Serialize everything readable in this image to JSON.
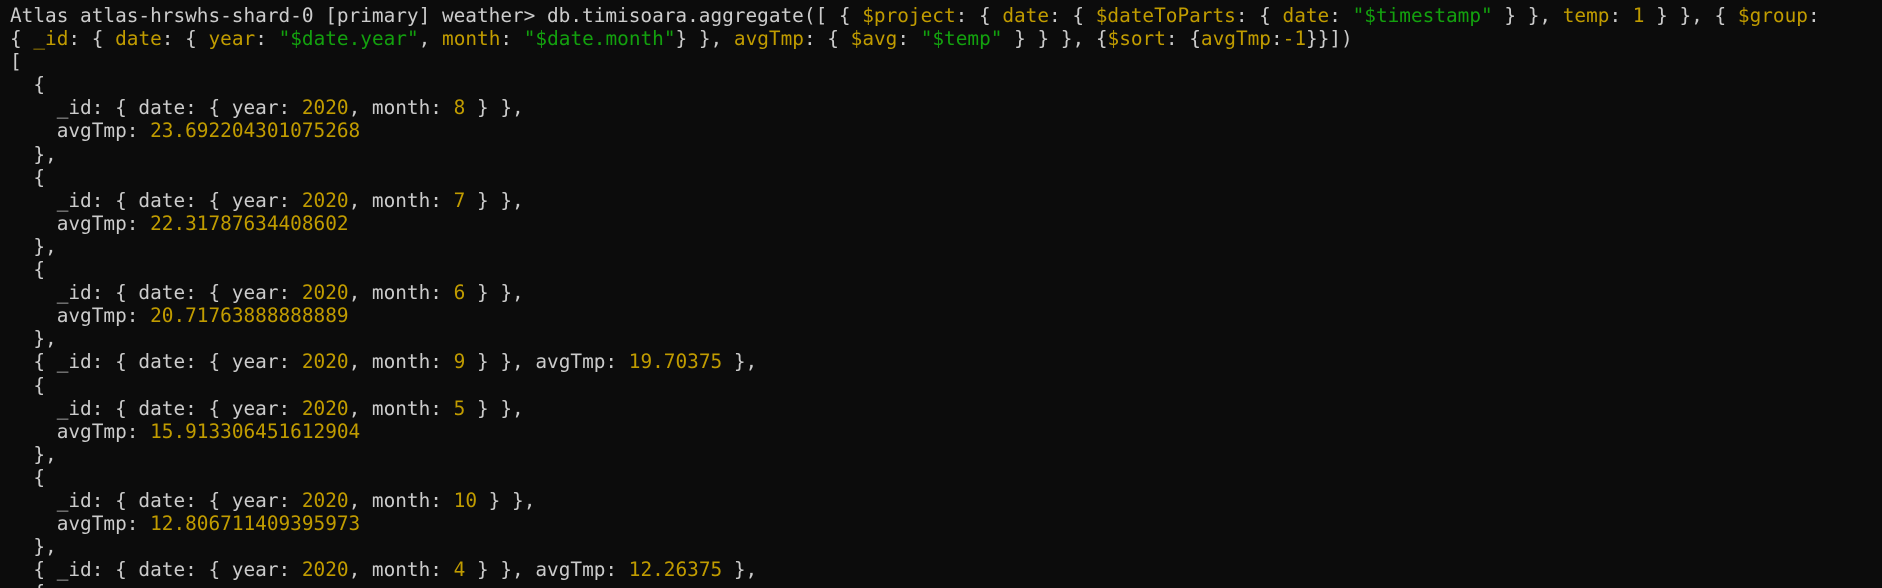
{
  "colors": {
    "background": "#0c0c0c",
    "text": "#cccccc",
    "key": "#c19c00",
    "string": "#13a10e"
  },
  "lines": [
    [
      {
        "t": "Atlas atlas-hrswhs-shard-0 [primary] weather> db.timisoara.aggregate([ { ",
        "c": "w"
      },
      {
        "t": "$project",
        "c": "k"
      },
      {
        "t": ": { ",
        "c": "w"
      },
      {
        "t": "date",
        "c": "k"
      },
      {
        "t": ": { ",
        "c": "w"
      },
      {
        "t": "$dateToParts",
        "c": "k"
      },
      {
        "t": ": { ",
        "c": "w"
      },
      {
        "t": "date",
        "c": "k"
      },
      {
        "t": ": ",
        "c": "w"
      },
      {
        "t": "\"$timestamp\"",
        "c": "s"
      },
      {
        "t": " } }, ",
        "c": "w"
      },
      {
        "t": "temp",
        "c": "k"
      },
      {
        "t": ": ",
        "c": "w"
      },
      {
        "t": "1",
        "c": "k"
      },
      {
        "t": " } }, { ",
        "c": "w"
      },
      {
        "t": "$group",
        "c": "k"
      },
      {
        "t": ":",
        "c": "w"
      }
    ],
    [
      {
        "t": "{ ",
        "c": "w"
      },
      {
        "t": "_id",
        "c": "k"
      },
      {
        "t": ": { ",
        "c": "w"
      },
      {
        "t": "date",
        "c": "k"
      },
      {
        "t": ": { ",
        "c": "w"
      },
      {
        "t": "year",
        "c": "k"
      },
      {
        "t": ": ",
        "c": "w"
      },
      {
        "t": "\"$date.year\"",
        "c": "s"
      },
      {
        "t": ", ",
        "c": "w"
      },
      {
        "t": "month",
        "c": "k"
      },
      {
        "t": ": ",
        "c": "w"
      },
      {
        "t": "\"$date.month\"",
        "c": "s"
      },
      {
        "t": "} }, ",
        "c": "w"
      },
      {
        "t": "avgTmp",
        "c": "k"
      },
      {
        "t": ": { ",
        "c": "w"
      },
      {
        "t": "$avg",
        "c": "k"
      },
      {
        "t": ": ",
        "c": "w"
      },
      {
        "t": "\"$temp\"",
        "c": "s"
      },
      {
        "t": " } } }, {",
        "c": "w"
      },
      {
        "t": "$sort",
        "c": "k"
      },
      {
        "t": ": {",
        "c": "w"
      },
      {
        "t": "avgTmp",
        "c": "k"
      },
      {
        "t": ":",
        "c": "w"
      },
      {
        "t": "-1",
        "c": "k"
      },
      {
        "t": "}}])",
        "c": "w"
      }
    ],
    [
      {
        "t": "[",
        "c": "w"
      }
    ],
    [
      {
        "t": "  {",
        "c": "w"
      }
    ],
    [
      {
        "t": "    _id: { date: { year: ",
        "c": "w"
      },
      {
        "t": "2020",
        "c": "k"
      },
      {
        "t": ", month: ",
        "c": "w"
      },
      {
        "t": "8",
        "c": "k"
      },
      {
        "t": " } },",
        "c": "w"
      }
    ],
    [
      {
        "t": "    avgTmp: ",
        "c": "w"
      },
      {
        "t": "23.692204301075268",
        "c": "k"
      }
    ],
    [
      {
        "t": "  },",
        "c": "w"
      }
    ],
    [
      {
        "t": "  {",
        "c": "w"
      }
    ],
    [
      {
        "t": "    _id: { date: { year: ",
        "c": "w"
      },
      {
        "t": "2020",
        "c": "k"
      },
      {
        "t": ", month: ",
        "c": "w"
      },
      {
        "t": "7",
        "c": "k"
      },
      {
        "t": " } },",
        "c": "w"
      }
    ],
    [
      {
        "t": "    avgTmp: ",
        "c": "w"
      },
      {
        "t": "22.31787634408602",
        "c": "k"
      }
    ],
    [
      {
        "t": "  },",
        "c": "w"
      }
    ],
    [
      {
        "t": "  {",
        "c": "w"
      }
    ],
    [
      {
        "t": "    _id: { date: { year: ",
        "c": "w"
      },
      {
        "t": "2020",
        "c": "k"
      },
      {
        "t": ", month: ",
        "c": "w"
      },
      {
        "t": "6",
        "c": "k"
      },
      {
        "t": " } },",
        "c": "w"
      }
    ],
    [
      {
        "t": "    avgTmp: ",
        "c": "w"
      },
      {
        "t": "20.71763888888889",
        "c": "k"
      }
    ],
    [
      {
        "t": "  },",
        "c": "w"
      }
    ],
    [
      {
        "t": "  { _id: { date: { year: ",
        "c": "w"
      },
      {
        "t": "2020",
        "c": "k"
      },
      {
        "t": ", month: ",
        "c": "w"
      },
      {
        "t": "9",
        "c": "k"
      },
      {
        "t": " } }, avgTmp: ",
        "c": "w"
      },
      {
        "t": "19.70375",
        "c": "k"
      },
      {
        "t": " },",
        "c": "w"
      }
    ],
    [
      {
        "t": "  {",
        "c": "w"
      }
    ],
    [
      {
        "t": "    _id: { date: { year: ",
        "c": "w"
      },
      {
        "t": "2020",
        "c": "k"
      },
      {
        "t": ", month: ",
        "c": "w"
      },
      {
        "t": "5",
        "c": "k"
      },
      {
        "t": " } },",
        "c": "w"
      }
    ],
    [
      {
        "t": "    avgTmp: ",
        "c": "w"
      },
      {
        "t": "15.913306451612904",
        "c": "k"
      }
    ],
    [
      {
        "t": "  },",
        "c": "w"
      }
    ],
    [
      {
        "t": "  {",
        "c": "w"
      }
    ],
    [
      {
        "t": "    _id: { date: { year: ",
        "c": "w"
      },
      {
        "t": "2020",
        "c": "k"
      },
      {
        "t": ", month: ",
        "c": "w"
      },
      {
        "t": "10",
        "c": "k"
      },
      {
        "t": " } },",
        "c": "w"
      }
    ],
    [
      {
        "t": "    avgTmp: ",
        "c": "w"
      },
      {
        "t": "12.806711409395973",
        "c": "k"
      }
    ],
    [
      {
        "t": "  },",
        "c": "w"
      }
    ],
    [
      {
        "t": "  { _id: { date: { year: ",
        "c": "w"
      },
      {
        "t": "2020",
        "c": "k"
      },
      {
        "t": ", month: ",
        "c": "w"
      },
      {
        "t": "4",
        "c": "k"
      },
      {
        "t": " } }, avgTmp: ",
        "c": "w"
      },
      {
        "t": "12.26375",
        "c": "k"
      },
      {
        "t": " },",
        "c": "w"
      }
    ],
    [
      {
        "t": "  {",
        "c": "w"
      }
    ]
  ]
}
